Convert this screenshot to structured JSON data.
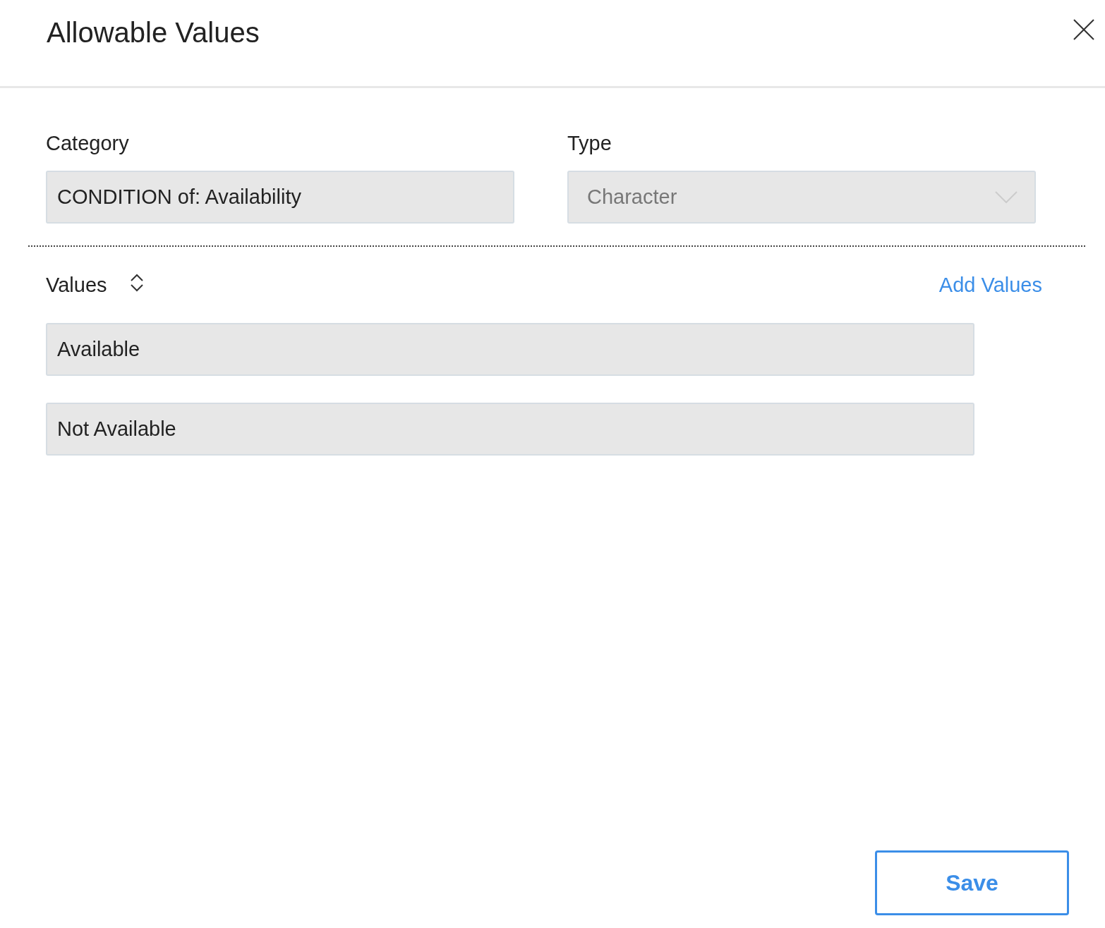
{
  "dialog": {
    "title": "Allowable Values"
  },
  "category": {
    "label": "Category",
    "value": "CONDITION of: Availability",
    "disabled": false
  },
  "type": {
    "label": "Type",
    "value": "Character",
    "disabled": true
  },
  "values": {
    "label": "Values",
    "add_link": "Add Values",
    "items": [
      "Available",
      "Not Available"
    ]
  },
  "save_button": "Save"
}
